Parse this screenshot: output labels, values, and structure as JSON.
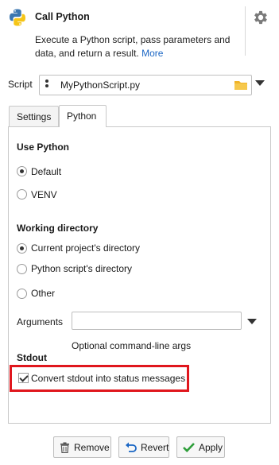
{
  "header": {
    "title": "Call Python",
    "description": "Execute a Python script, pass parameters and data, and return a result.",
    "more_link": "More"
  },
  "script": {
    "label": "Script",
    "value": "MyPythonScript.py"
  },
  "tabs": [
    {
      "label": "Settings",
      "active": false
    },
    {
      "label": "Python",
      "active": true
    }
  ],
  "use_python": {
    "title": "Use Python",
    "options": [
      {
        "label": "Default",
        "checked": true
      },
      {
        "label": "VENV",
        "checked": false
      }
    ]
  },
  "working_directory": {
    "title": "Working directory",
    "options": [
      {
        "label": "Current project's directory",
        "checked": true
      },
      {
        "label": "Python script's directory",
        "checked": false
      },
      {
        "label": "Other",
        "checked": false
      }
    ]
  },
  "arguments": {
    "label": "Arguments",
    "value": "",
    "hint": "Optional command-line args"
  },
  "stdout": {
    "title": "Stdout",
    "checkbox_label": "Convert stdout into status messages",
    "checked": true,
    "highlight_color": "#e0161d"
  },
  "buttons": {
    "remove": "Remove",
    "revert": "Revert",
    "apply": "Apply"
  },
  "colors": {
    "link": "#1a66c4",
    "apply_check": "#2e9e3a",
    "revert_arrow": "#1a66c4",
    "folder": "#f0b429"
  }
}
